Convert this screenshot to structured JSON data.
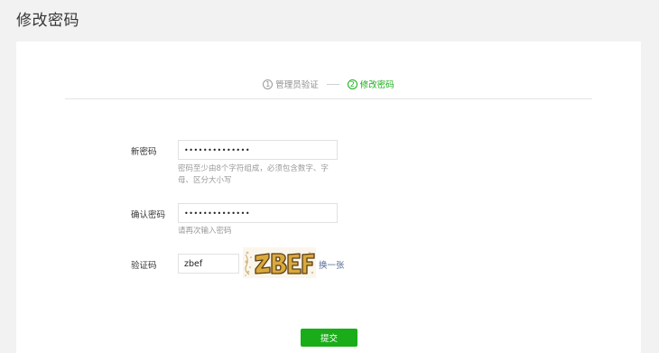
{
  "page": {
    "title": "修改密码"
  },
  "steps": [
    {
      "num": "1",
      "label": "管理员验证",
      "active": false
    },
    {
      "num": "2",
      "label": "修改密码",
      "active": true
    }
  ],
  "form": {
    "new_password": {
      "label": "新密码",
      "value": "••••••••••••••",
      "hint_line1": "密码至少由8个字符组成，必须包含数字、字",
      "hint_line2": "母、区分大小写"
    },
    "confirm_password": {
      "label": "确认密码",
      "value": "••••••••••••••",
      "hint": "请再次输入密码"
    },
    "captcha": {
      "label": "验证码",
      "value": "zbef",
      "image_text": "ZBEF",
      "refresh_label": "换一张"
    },
    "submit_label": "提交"
  },
  "colors": {
    "accent": "#1aad19",
    "link": "#576b95",
    "background": "#f2f2f2"
  }
}
